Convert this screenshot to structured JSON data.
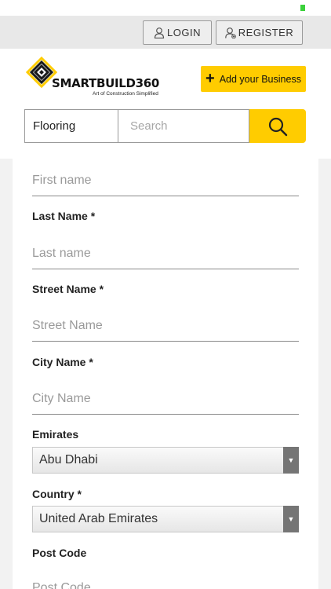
{
  "auth": {
    "login_label": "LOGIN",
    "register_label": "REGISTER"
  },
  "brand": {
    "name": "SMARTBUILD360",
    "tagline": "Art of Construction Simplified"
  },
  "header": {
    "add_business_label": "Add your Business"
  },
  "search": {
    "category": "Flooring",
    "placeholder": "Search"
  },
  "form": {
    "first_name": {
      "placeholder": "First name"
    },
    "last_name": {
      "label": "Last Name *",
      "placeholder": "Last name"
    },
    "street_name": {
      "label": "Street Name *",
      "placeholder": "Street Name"
    },
    "city_name": {
      "label": "City Name *",
      "placeholder": "City Name"
    },
    "emirates": {
      "label": "Emirates",
      "value": "Abu Dhabi"
    },
    "country": {
      "label": "Country *",
      "value": "United Arab Emirates"
    },
    "post_code": {
      "label": "Post Code",
      "placeholder": "Post Code"
    }
  },
  "colors": {
    "accent": "#ffcc00",
    "status_dot": "#3bd13b"
  }
}
